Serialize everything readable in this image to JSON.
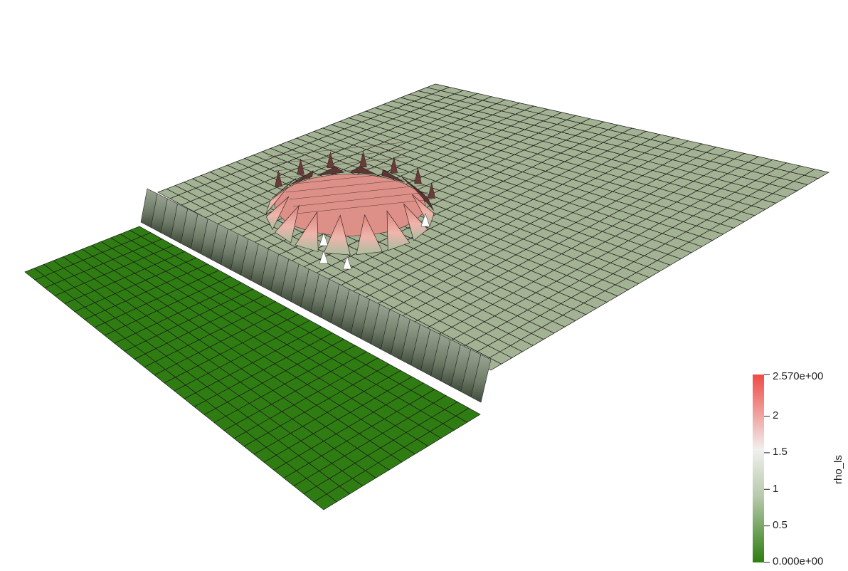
{
  "scene": {
    "description_colors": {
      "low": "#2d7e0f",
      "mid_low": "#8eae77",
      "mid": "#e6e8e2",
      "high": "#f5504a",
      "background": "#ffffff"
    },
    "surfaces": [
      {
        "name": "left-flat-plate",
        "value": 0.0
      },
      {
        "name": "main-flat-plate",
        "value": 0.9
      },
      {
        "name": "wall-strip",
        "value": 0.85
      },
      {
        "name": "central-bump",
        "value": 2.2
      }
    ]
  },
  "colorbar": {
    "title": "rho_ls",
    "max_label": "2.570e+00",
    "min_label": "0.000e+00",
    "ticks": [
      "2",
      "1.5",
      "1",
      "0.5"
    ],
    "range": [
      0,
      2.57
    ],
    "tick_values": [
      2,
      1.5,
      1,
      0.5
    ],
    "colors": [
      "#2d7e0f",
      "#b7c9ab",
      "#f0f0ee",
      "#f04a45"
    ]
  }
}
